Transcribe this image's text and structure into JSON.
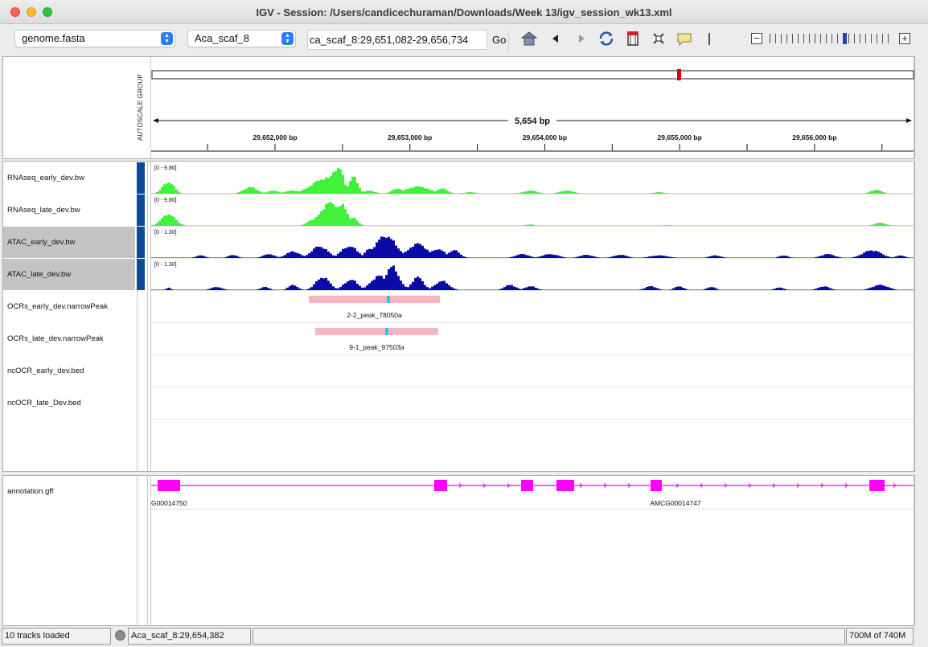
{
  "window": {
    "title": "IGV - Session: /Users/candicechuraman/Downloads/Week 13/igv_session_wk13.xml"
  },
  "toolbar": {
    "genome_select": "genome.fasta",
    "chromosome_select": "Aca_scaf_8",
    "locus_value": "ca_scaf_8:29,651,082-29,656,734",
    "go_label": "Go",
    "icons": [
      "home-icon",
      "back-icon",
      "forward-icon",
      "refresh-icon",
      "roi-icon",
      "resize-icon",
      "popup-text-icon"
    ],
    "zoom_level": 0.62
  },
  "ruler": {
    "span_label": "5,654 bp",
    "ticks": [
      {
        "label": "29,652,000 bp",
        "pos": 29652000
      },
      {
        "label": "29,653,000 bp",
        "pos": 29653000
      },
      {
        "label": "29,654,000 bp",
        "pos": 29654000
      },
      {
        "label": "29,655,000 bp",
        "pos": 29655000
      },
      {
        "label": "29,656,000 bp",
        "pos": 29656000
      }
    ],
    "view_start": 29651082,
    "view_end": 29656734,
    "autoscale_label": "AUTOSCALE GROUP"
  },
  "tracks": [
    {
      "name": "RNAseq_early_dev.bw",
      "range": "[0 - 9.80]",
      "color": "#42f23a",
      "selected": false
    },
    {
      "name": "RNAseq_late_dev.bw",
      "range": "[0 - 9.80]",
      "color": "#42f23a",
      "selected": false
    },
    {
      "name": "ATAC_early_dev.bw",
      "range": "[0 - 1.30]",
      "color": "#0a0aa6",
      "selected": true
    },
    {
      "name": "ATAC_late_dev.bw",
      "range": "[0 - 1.30]",
      "color": "#0a0aa6",
      "selected": true
    },
    {
      "name": "OCRs_early_dev.narrowPeak",
      "feature_label": "2-2_peak_78050a",
      "color": "#f7b6c2"
    },
    {
      "name": "OCRs_late_dev.narrowPeak",
      "feature_label": "9-1_peak_97503a",
      "color": "#f7b6c2"
    },
    {
      "name": "ncOCR_early_dev.bed"
    },
    {
      "name": "ncOCR_late_Dev.bed"
    }
  ],
  "annotation": {
    "name": "annotation.gff",
    "genes": [
      {
        "label": "G00014750"
      },
      {
        "label": "AMCG00014747"
      }
    ],
    "color": "#ff00ff"
  },
  "status": {
    "tracks_loaded": "10 tracks loaded",
    "position": "Aca_scaf_8:29,654,382",
    "memory": "700M of 740M"
  }
}
